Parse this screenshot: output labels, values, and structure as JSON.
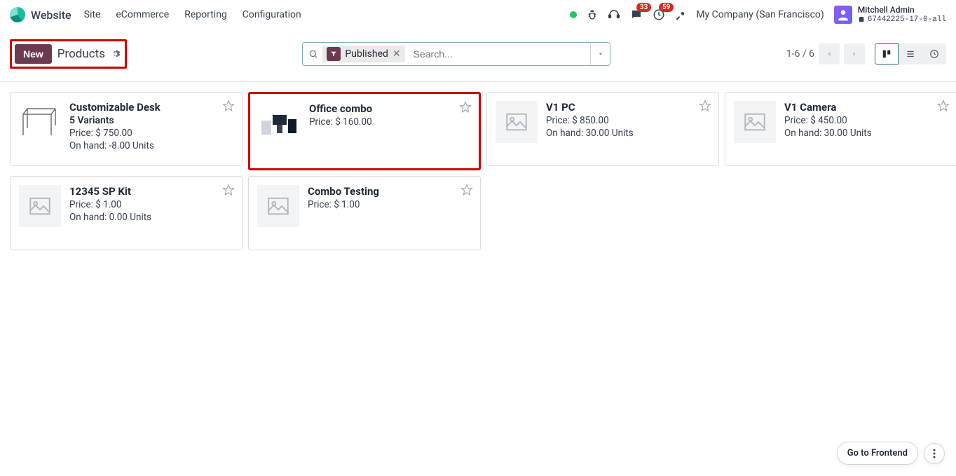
{
  "brand": {
    "name": "Website"
  },
  "nav": {
    "items": [
      "Site",
      "eCommerce",
      "Reporting",
      "Configuration"
    ]
  },
  "systray": {
    "messages_badge": "33",
    "activities_badge": "59",
    "company": "My Company (San Francisco)",
    "user_name": "Mitchell Admin",
    "db": "67442225-17-0-all"
  },
  "toolbar": {
    "new_label": "New",
    "heading": "Products"
  },
  "search": {
    "chip_label": "Published",
    "placeholder": "Search..."
  },
  "pager": {
    "text": "1-6 / 6"
  },
  "price_prefix": "Price: ",
  "onhand_prefix": "On hand: ",
  "products": [
    {
      "name": "Customizable Desk",
      "variants": "5 Variants",
      "price": "$ 750.00",
      "onhand": "-8.00 Units",
      "thumb": "desk"
    },
    {
      "name": "Office combo",
      "price": "$ 160.00",
      "thumb": "combo"
    },
    {
      "name": "V1 PC",
      "price": "$ 850.00",
      "onhand": "30.00 Units",
      "thumb": "placeholder"
    },
    {
      "name": "V1 Camera",
      "price": "$ 450.00",
      "onhand": "30.00 Units",
      "thumb": "placeholder"
    },
    {
      "name": "12345 SP Kit",
      "price": "$ 1.00",
      "onhand": "0.00 Units",
      "thumb": "placeholder"
    },
    {
      "name": "Combo Testing",
      "price": "$ 1.00",
      "thumb": "placeholder"
    }
  ],
  "float": {
    "frontend": "Go to Frontend"
  }
}
